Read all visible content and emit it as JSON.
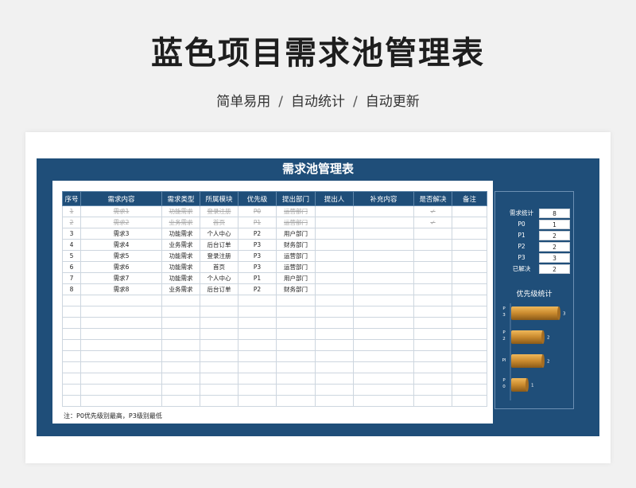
{
  "page": {
    "title": "蓝色项目需求池管理表",
    "tagline": [
      "简单易用",
      "自动统计",
      "自动更新"
    ],
    "tagline_sep": "/"
  },
  "sheet": {
    "title": "需求池管理表",
    "headers": [
      "序号",
      "需求内容",
      "需求类型",
      "所属模块",
      "优先级",
      "提出部门",
      "提出人",
      "补充内容",
      "是否解决",
      "备注"
    ],
    "rows": [
      {
        "no": "1",
        "content": "需求1",
        "type": "功能需求",
        "module": "登录注册",
        "priority": "P0",
        "dept": "运营部门",
        "person": "",
        "extra": "",
        "resolved": "✓",
        "remark": "",
        "done": true
      },
      {
        "no": "2",
        "content": "需求2",
        "type": "业务需求",
        "module": "首页",
        "priority": "P1",
        "dept": "运营部门",
        "person": "",
        "extra": "",
        "resolved": "✓",
        "remark": "",
        "done": true
      },
      {
        "no": "3",
        "content": "需求3",
        "type": "功能需求",
        "module": "个人中心",
        "priority": "P2",
        "dept": "用户部门",
        "person": "",
        "extra": "",
        "resolved": "",
        "remark": "",
        "done": false
      },
      {
        "no": "4",
        "content": "需求4",
        "type": "业务需求",
        "module": "后台订单",
        "priority": "P3",
        "dept": "财务部门",
        "person": "",
        "extra": "",
        "resolved": "",
        "remark": "",
        "done": false
      },
      {
        "no": "5",
        "content": "需求5",
        "type": "功能需求",
        "module": "登录注册",
        "priority": "P3",
        "dept": "运营部门",
        "person": "",
        "extra": "",
        "resolved": "",
        "remark": "",
        "done": false
      },
      {
        "no": "6",
        "content": "需求6",
        "type": "功能需求",
        "module": "首页",
        "priority": "P3",
        "dept": "运营部门",
        "person": "",
        "extra": "",
        "resolved": "",
        "remark": "",
        "done": false
      },
      {
        "no": "7",
        "content": "需求7",
        "type": "功能需求",
        "module": "个人中心",
        "priority": "P1",
        "dept": "用户部门",
        "person": "",
        "extra": "",
        "resolved": "",
        "remark": "",
        "done": false
      },
      {
        "no": "8",
        "content": "需求8",
        "type": "业务需求",
        "module": "后台订单",
        "priority": "P2",
        "dept": "财务部门",
        "person": "",
        "extra": "",
        "resolved": "",
        "remark": "",
        "done": false
      }
    ],
    "empty_rows": 10,
    "note": "注：P0优先级别最高，P3级别最低"
  },
  "stats": [
    {
      "label": "需求统计",
      "value": "8"
    },
    {
      "label": "P0",
      "value": "1"
    },
    {
      "label": "P1",
      "value": "2"
    },
    {
      "label": "P2",
      "value": "2"
    },
    {
      "label": "P3",
      "value": "3"
    },
    {
      "label": "已解决",
      "value": "2"
    }
  ],
  "chart_data": {
    "type": "bar",
    "orientation": "horizontal",
    "title": "优先级统计",
    "categories": [
      "P3",
      "P2",
      "P1",
      "P0"
    ],
    "category_labels": [
      [
        "P",
        "3"
      ],
      [
        "P",
        "2"
      ],
      [
        "PI"
      ],
      [
        "P",
        "0"
      ]
    ],
    "values": [
      3,
      2,
      2,
      1
    ],
    "xlim": [
      0,
      3
    ],
    "bar_color": "#c98a2e"
  },
  "colors": {
    "frame": "#1f4e79",
    "bar": "#c98a2e"
  }
}
